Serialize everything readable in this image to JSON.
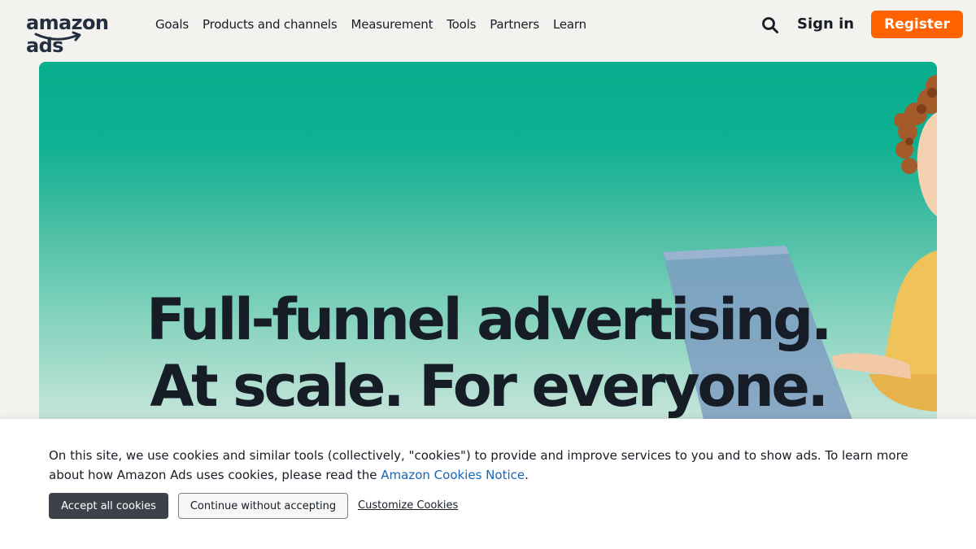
{
  "header": {
    "logo_text": "amazon ads",
    "nav": [
      {
        "label": "Goals"
      },
      {
        "label": "Products and channels"
      },
      {
        "label": "Measurement"
      },
      {
        "label": "Tools"
      },
      {
        "label": "Partners"
      },
      {
        "label": "Learn"
      }
    ],
    "search_icon": "search-icon",
    "signin_label": "Sign in",
    "register_label": "Register",
    "register_color": "#ff6200"
  },
  "hero": {
    "headline_line1": "Full-funnel advertising.",
    "headline_line2": "At scale. For everyone.",
    "accent_color": "#08ae8d"
  },
  "cookie_banner": {
    "text_before": "On this site, we use cookies and similar tools (collectively, \"cookies\") to provide and improve services to you and to show ads. To learn more about how Amazon Ads uses cookies, please read the ",
    "link_text": "Amazon Cookies Notice",
    "text_after": ".",
    "accept_label": "Accept all cookies",
    "continue_label": "Continue without accepting",
    "customize_label": "Customize Cookies"
  }
}
